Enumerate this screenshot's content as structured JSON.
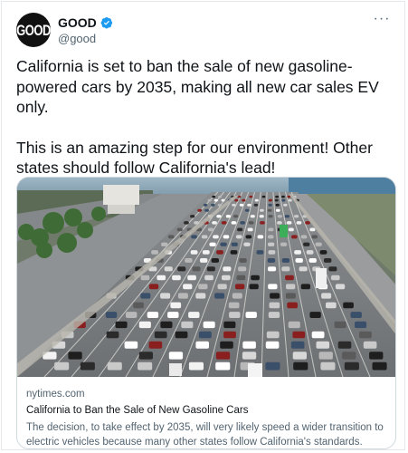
{
  "author": {
    "display_name": "GOOD",
    "handle": "@good",
    "avatar_text": "GOOD",
    "verified": true
  },
  "more_label": "···",
  "tweet": {
    "paragraphs": [
      "California is set to ban the sale of new gasoline-powered cars by 2035, making all new car sales EV only.",
      "This is an amazing step for our environment! Other states should follow California's lead!"
    ]
  },
  "card": {
    "image_icon": "highway-traffic-photo",
    "domain": "nytimes.com",
    "title": "California to Ban the Sale of New Gasoline Cars",
    "description": "The decision, to take effect by 2035, will very likely speed a wider transition to electric vehicles because many other states follow California's standards."
  },
  "colors": {
    "verified_blue": "#1d9bf0",
    "text_secondary": "#536471",
    "card_border": "#cfd9de"
  }
}
